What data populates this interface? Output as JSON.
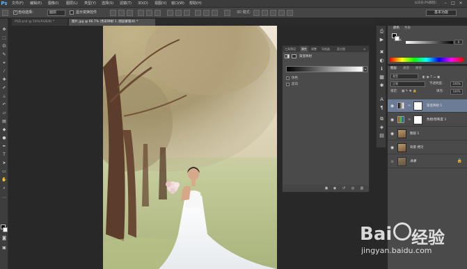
{
  "app": {
    "logo": "Ps"
  },
  "menu": [
    "文件(F)",
    "编辑(E)",
    "图像(I)",
    "图层(L)",
    "类型(Y)",
    "选择(S)",
    "滤镜(T)",
    "3D(D)",
    "视图(V)",
    "窗口(W)",
    "帮助(H)"
  ],
  "window": {
    "title": "以日东(PS教程)",
    "min": "–",
    "max": "□",
    "close": "×"
  },
  "options": {
    "auto_select_label": "自动选择：",
    "auto_select_value": "图层",
    "show_transform_label": "显示变换控件",
    "workspace": "基本功能"
  },
  "tabs": [
    {
      "label": "PSD.psd @ 50%(RGB/8) *"
    },
    {
      "label": "图片.jpg @ 66.7% (色彩映射 1, 图层蒙版/8) *"
    }
  ],
  "properties": {
    "tabs": [
      "工具预设",
      "属性",
      "调整",
      "导航器",
      "直方图"
    ],
    "active_tab": "属性",
    "header": "渐变映射",
    "options": [
      {
        "label": "仿色",
        "checked": false
      },
      {
        "label": "反向",
        "checked": false
      }
    ]
  },
  "right_panels": {
    "color_tabs": [
      "颜色",
      "色板"
    ],
    "color_k_label": "K",
    "color_k_value": "0",
    "layer_tabs": [
      "图层",
      "通道",
      "路径"
    ],
    "kind": "类型",
    "blend_mode": "正常",
    "opacity_label": "不透明度:",
    "opacity_value": "100%",
    "lock_label": "锁定:",
    "fill_label": "填充:",
    "fill_value": "100%"
  },
  "layers": [
    {
      "name": "渐变映射 1",
      "type": "adjustment",
      "active": true
    },
    {
      "name": "色相/饱和度 1",
      "type": "adjustment",
      "active": false
    },
    {
      "name": "图层 1",
      "type": "image",
      "active": false
    },
    {
      "name": "背景 拷贝",
      "type": "image",
      "active": false
    },
    {
      "name": "背景",
      "type": "background",
      "active": false
    }
  ],
  "watermark": {
    "brand": "Bai",
    "brand2": "du",
    "sub": "经验",
    "url": "jingyan.baidu.com"
  }
}
